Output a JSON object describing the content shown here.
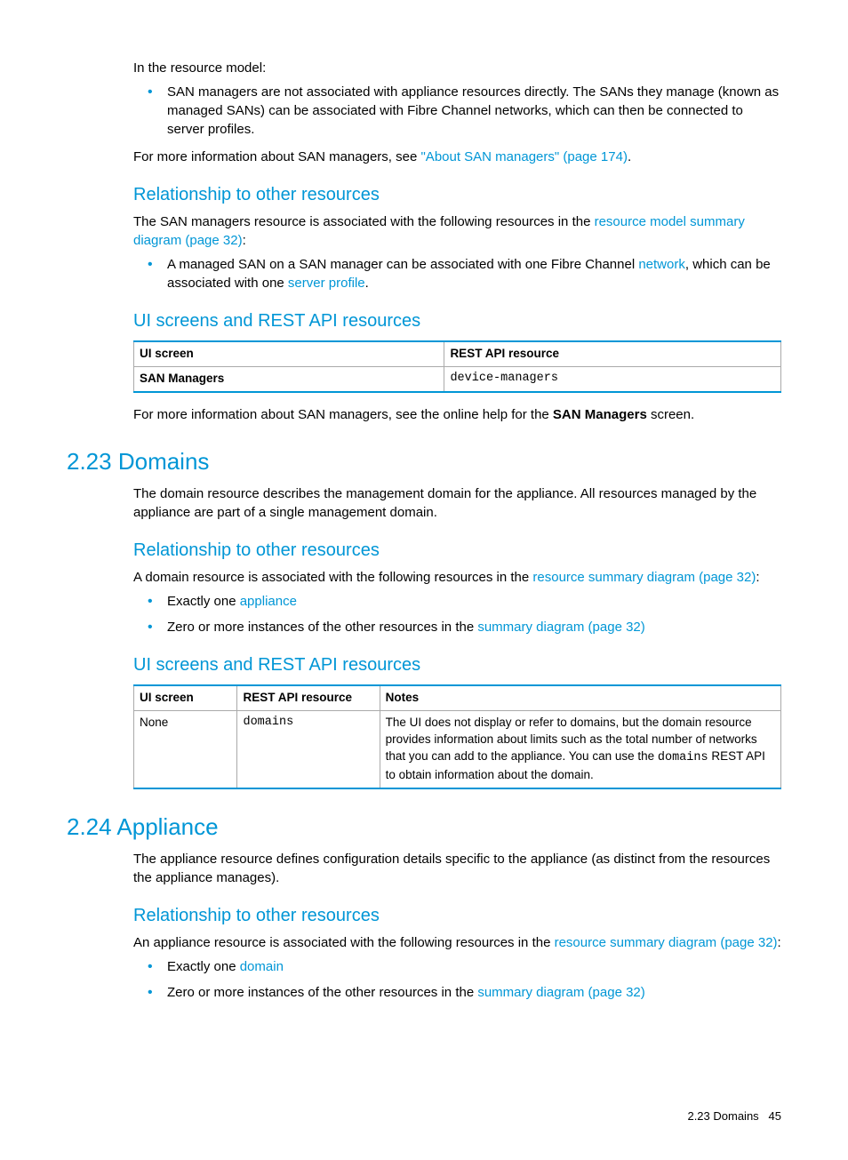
{
  "intro": {
    "p1": "In the resource model:",
    "li1": "SAN managers are not associated with appliance resources directly. The SANs they manage (known as managed SANs) can be associated with Fibre Channel networks, which can then be connected to server profiles.",
    "p2_a": "For more information about SAN managers, see ",
    "p2_link": "\"About SAN managers\" (page 174)",
    "p2_b": "."
  },
  "rel1": {
    "heading": "Relationship to other resources",
    "p1_a": "The SAN managers resource is associated with the following resources in the ",
    "p1_link": "resource model summary diagram (page 32)",
    "p1_b": ":",
    "li1_a": "A managed SAN on a SAN manager can be associated with one Fibre Channel ",
    "li1_link1": "network",
    "li1_b": ", which can be associated with one ",
    "li1_link2": "server profile",
    "li1_c": "."
  },
  "ui1": {
    "heading": "UI screens and REST API resources",
    "th1": "UI screen",
    "th2": "REST API resource",
    "td1": "SAN Managers",
    "td2": "device-managers",
    "p_after_a": "For more information about SAN managers, see the online help for the ",
    "p_after_bold": "SAN Managers",
    "p_after_b": " screen."
  },
  "domains": {
    "heading": "2.23 Domains",
    "p1": "The domain resource describes the management domain for the appliance. All resources managed by the appliance are part of a single management domain.",
    "rel_heading": "Relationship to other resources",
    "rel_p_a": "A domain resource is associated with the following resources in the ",
    "rel_p_link": "resource summary diagram (page 32)",
    "rel_p_b": ":",
    "li1_a": "Exactly one ",
    "li1_link": "appliance",
    "li2_a": "Zero or more instances of the other resources in the ",
    "li2_link": "summary diagram (page 32)",
    "ui_heading": "UI screens and REST API resources",
    "th1": "UI screen",
    "th2": "REST API resource",
    "th3": "Notes",
    "td1": "None",
    "td2": "domains",
    "td3_a": "The UI does not display or refer to domains, but the domain resource provides information about limits such as the total number of networks that you can add to the appliance. You can use the ",
    "td3_mono": "domains",
    "td3_b": " REST API to obtain information about the domain."
  },
  "appliance": {
    "heading": "2.24 Appliance",
    "p1": "The appliance resource defines configuration details specific to the appliance (as distinct from the resources the appliance manages).",
    "rel_heading": "Relationship to other resources",
    "rel_p_a": "An appliance resource is associated with the following resources in the ",
    "rel_p_link": "resource summary diagram (page 32)",
    "rel_p_b": ":",
    "li1_a": "Exactly one ",
    "li1_link": "domain",
    "li2_a": "Zero or more instances of the other resources in the ",
    "li2_link": "summary diagram (page 32)"
  },
  "footer": {
    "section": "2.23 Domains",
    "page": "45"
  }
}
